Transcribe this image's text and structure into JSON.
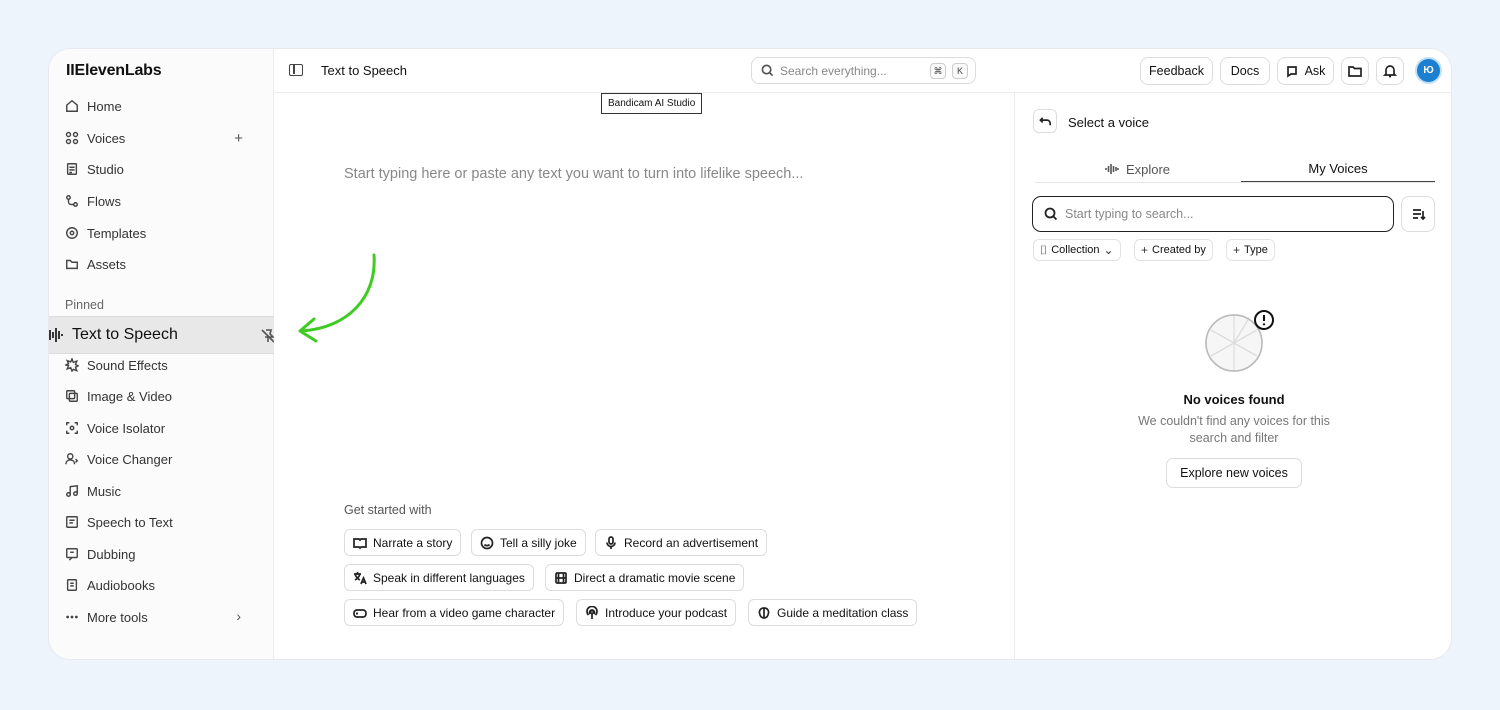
{
  "app": {
    "logo": "IIElevenLabs"
  },
  "sidebar": {
    "items": [
      {
        "label": "Home",
        "icon": "home-icon"
      },
      {
        "label": "Voices",
        "icon": "voices-grid-icon"
      },
      {
        "label": "Studio",
        "icon": "studio-icon"
      },
      {
        "label": "Flows",
        "icon": "flows-icon"
      },
      {
        "label": "Templates",
        "icon": "templates-icon"
      },
      {
        "label": "Assets",
        "icon": "folder-icon"
      }
    ],
    "voices_add": "+",
    "pinned_label": "Pinned",
    "pinned_item": {
      "label": "Text to Speech",
      "icon": "waveform-icon"
    },
    "tools": [
      {
        "label": "Sound Effects",
        "icon": "sound-effects-icon"
      },
      {
        "label": "Image & Video",
        "icon": "image-video-icon"
      },
      {
        "label": "Voice Isolator",
        "icon": "voice-isolator-icon"
      },
      {
        "label": "Voice Changer",
        "icon": "voice-changer-icon"
      },
      {
        "label": "Music",
        "icon": "music-icon"
      },
      {
        "label": "Speech to Text",
        "icon": "speech-to-text-icon"
      },
      {
        "label": "Dubbing",
        "icon": "dubbing-icon"
      },
      {
        "label": "Audiobooks",
        "icon": "audiobooks-icon"
      },
      {
        "label": "More tools",
        "icon": "more-dots-icon"
      }
    ],
    "more_chevron": "›"
  },
  "topbar": {
    "title": "Text to Speech",
    "search_placeholder": "Search everything...",
    "shortcut_keys": [
      "⌘",
      "K"
    ],
    "feedback": "Feedback",
    "docs": "Docs",
    "ask": "Ask",
    "avatar_initials": "Ю"
  },
  "editor": {
    "tooltip": "Bandicam AI Studio",
    "placeholder": "Start typing here or paste any text you want to turn into lifelike speech...",
    "get_started_label": "Get started with",
    "suggestions": [
      "Narrate a story",
      "Tell a silly joke",
      "Record an advertisement",
      "Speak in different languages",
      "Direct a dramatic movie scene",
      "Hear from a video game character",
      "Introduce your podcast",
      "Guide a meditation class"
    ]
  },
  "voice_panel": {
    "title": "Select a voice",
    "tabs": [
      "Explore",
      "My Voices"
    ],
    "active_tab": "My Voices",
    "search_placeholder": "Start typing to search...",
    "filters": [
      "Collection",
      "Created by",
      "Type"
    ],
    "empty_title": "No voices found",
    "empty_desc": "We couldn't find any voices for this search and filter",
    "explore_button": "Explore new voices"
  },
  "colors": {
    "annotation_arrow": "#3dcc1f",
    "avatar": "#1d7fd0",
    "background": "#eef4fb"
  }
}
